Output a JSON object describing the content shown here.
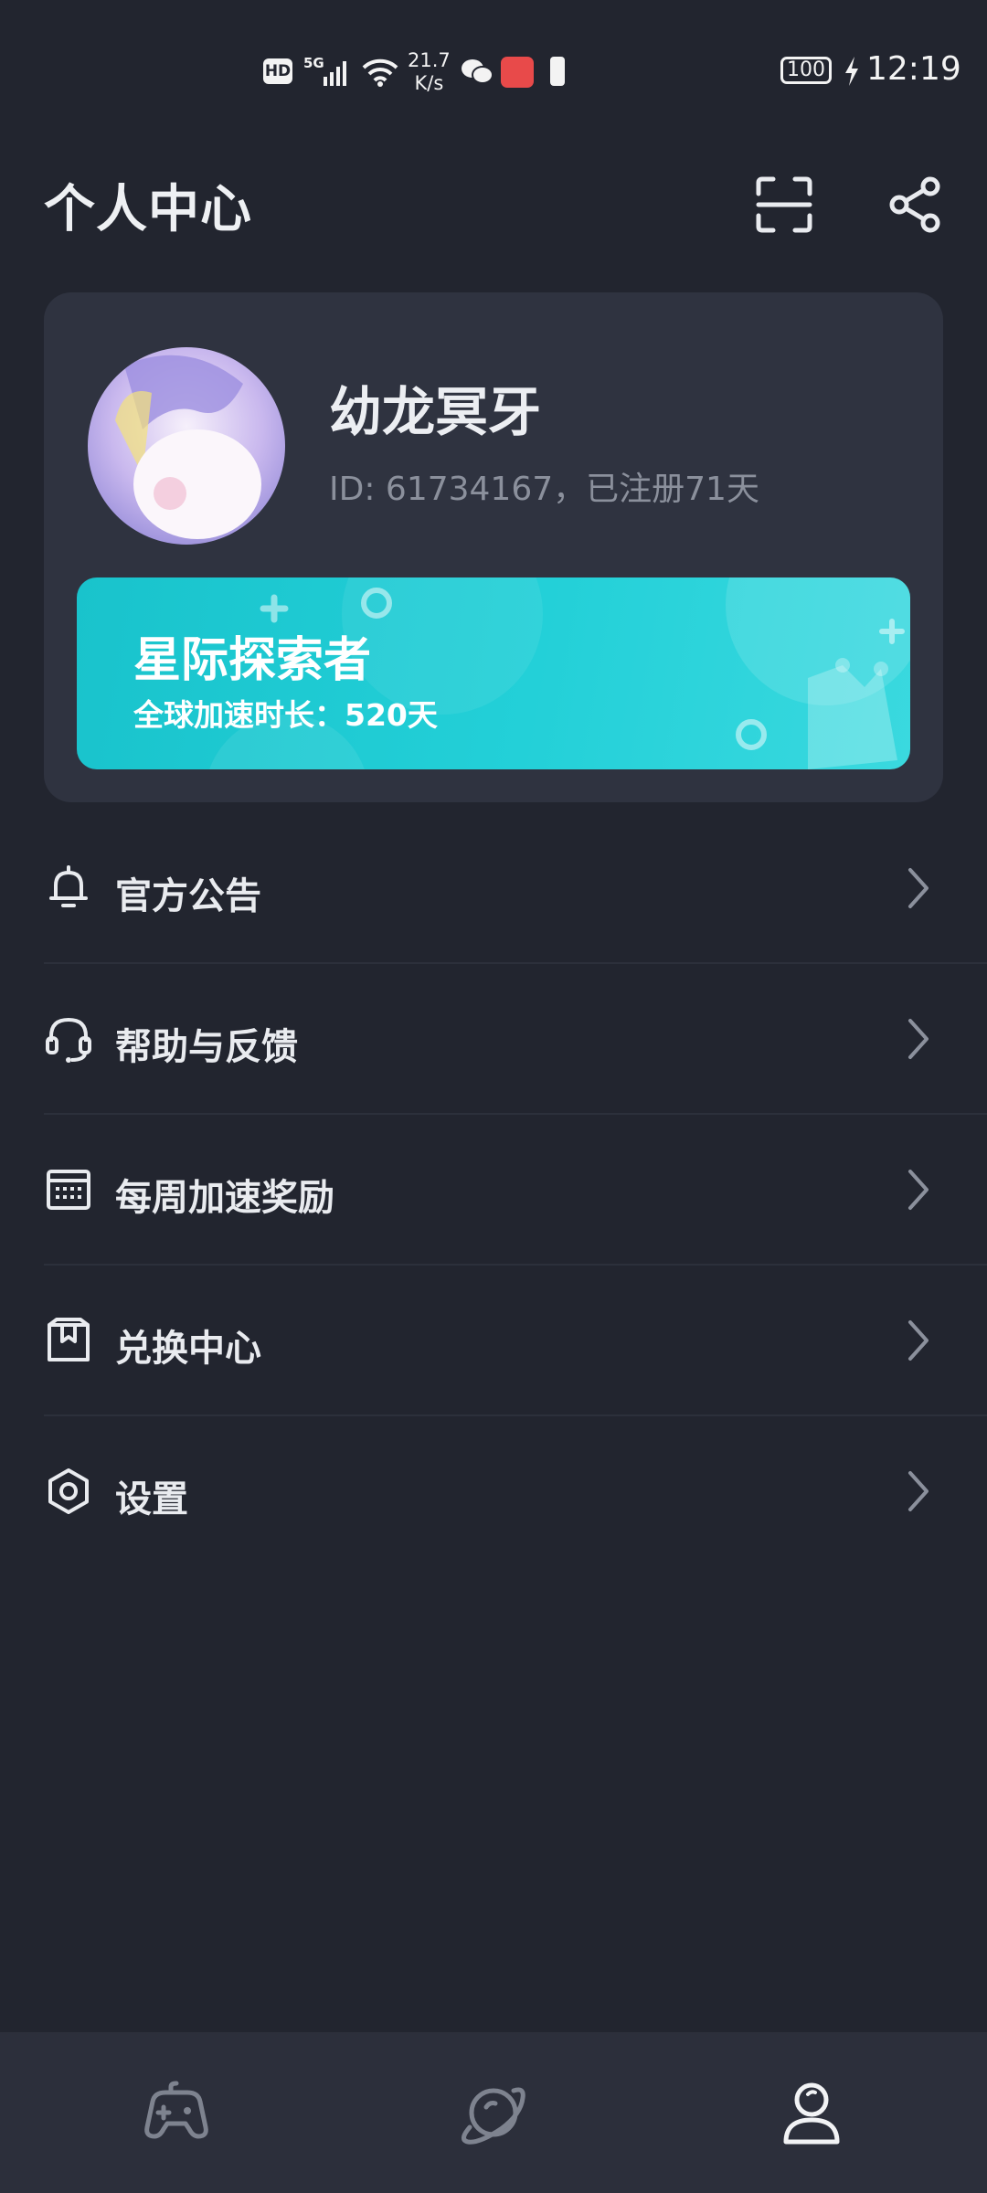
{
  "status_bar": {
    "hd": "HD",
    "network": "5G",
    "speed_value": "21.7",
    "speed_unit": "K/s",
    "battery": "100",
    "time": "12:19"
  },
  "header": {
    "title": "个人中心",
    "scan_icon": "scan-icon",
    "share_icon": "share-icon"
  },
  "profile": {
    "username": "幼龙冥牙",
    "id_line": "ID: 61734167，已注册71天"
  },
  "banner": {
    "title": "星际探索者",
    "subtitle": "全球加速时长：520天"
  },
  "menu": [
    {
      "label": "官方公告",
      "icon": "bell-icon"
    },
    {
      "label": "帮助与反馈",
      "icon": "headset-icon"
    },
    {
      "label": "每周加速奖励",
      "icon": "calendar-icon"
    },
    {
      "label": "兑换中心",
      "icon": "gift-box-icon"
    },
    {
      "label": "设置",
      "icon": "hexagon-settings-icon"
    }
  ],
  "bottom_nav": [
    {
      "icon": "gamepad-icon",
      "active": false
    },
    {
      "icon": "planet-icon",
      "active": false
    },
    {
      "icon": "user-icon",
      "active": true
    }
  ],
  "colors": {
    "background": "#22252f",
    "card": "#2f3340",
    "accent": "#1ec8d0",
    "text": "#e9ebef",
    "muted": "#8b909c"
  }
}
